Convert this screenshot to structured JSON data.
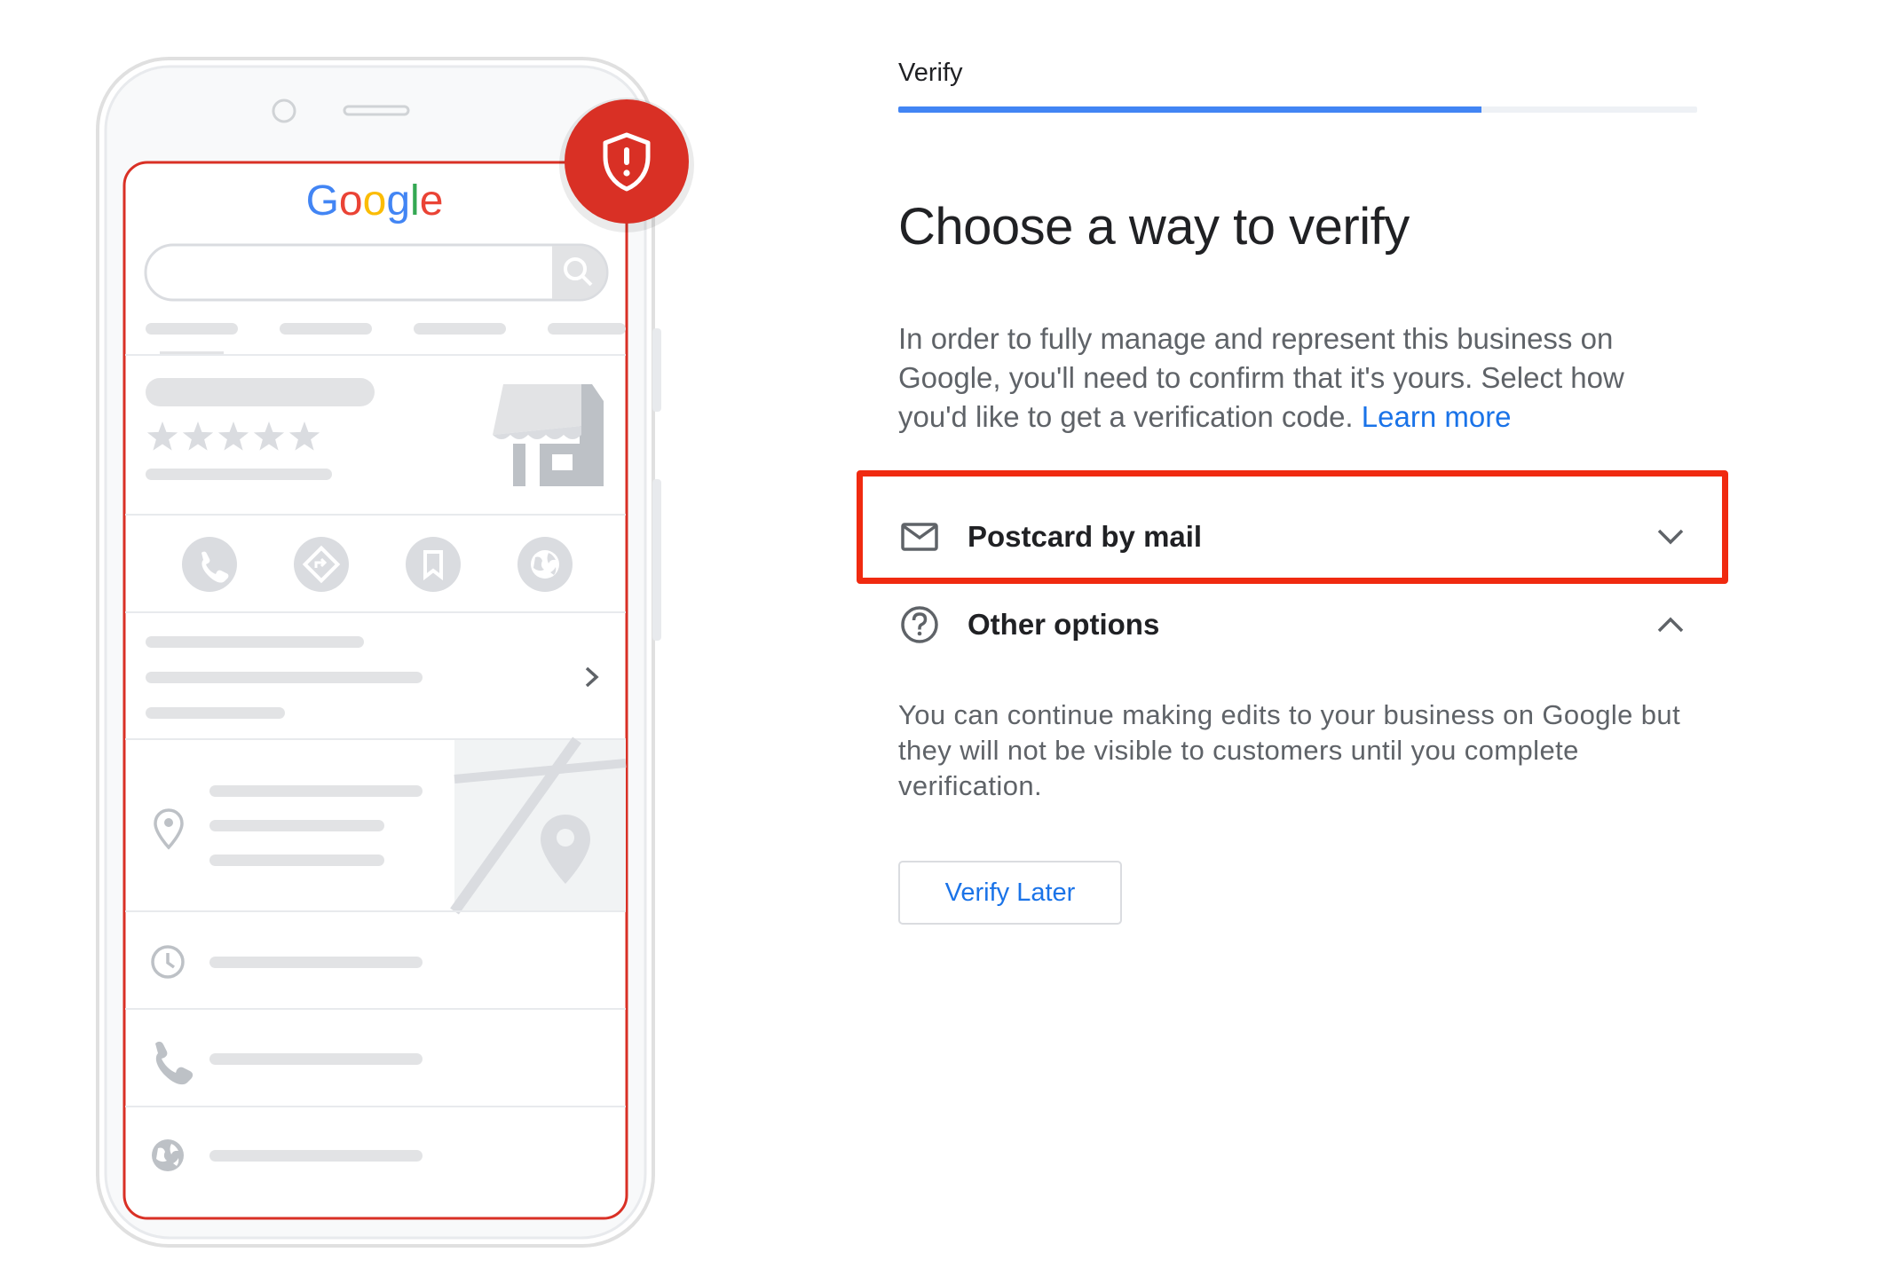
{
  "illustration": {
    "google_logo": "Google",
    "colors": {
      "phone_outline": "#e0e0e0",
      "screen_border": "#d93025",
      "badge": "#d93025",
      "placeholder": "#e2e3e5",
      "icon_gray": "#c4c7c9"
    },
    "icons": [
      "shield-alert-icon",
      "search-icon",
      "star-icon",
      "storefront-icon",
      "phone-icon",
      "directions-icon",
      "bookmark-icon",
      "globe-icon",
      "chevron-right-icon",
      "location-pin-icon",
      "map-icon",
      "clock-icon"
    ]
  },
  "panel": {
    "step_label": "Verify",
    "progress_percent": 73,
    "title": "Choose a way to verify",
    "intro_text": "In order to fully manage and represent this business on Google, you'll need to confirm that it's yours. Select how you'd like to get a verification code.",
    "learn_more": "Learn more",
    "options": [
      {
        "label": "Postcard by mail",
        "icon": "mail-icon",
        "chevron": "chevron-down-icon",
        "highlighted": true
      },
      {
        "label": "Other options",
        "icon": "help-circle-icon",
        "chevron": "chevron-up-icon",
        "expanded": true
      }
    ],
    "other_options_text": "You can continue making edits to your business on Google but they will not be visible to customers until you complete verification.",
    "verify_later": "Verify Later",
    "colors": {
      "accent": "#1a73e8",
      "progress": "#4285f4",
      "highlight": "#f02a10",
      "body_text": "#5f6368"
    }
  }
}
